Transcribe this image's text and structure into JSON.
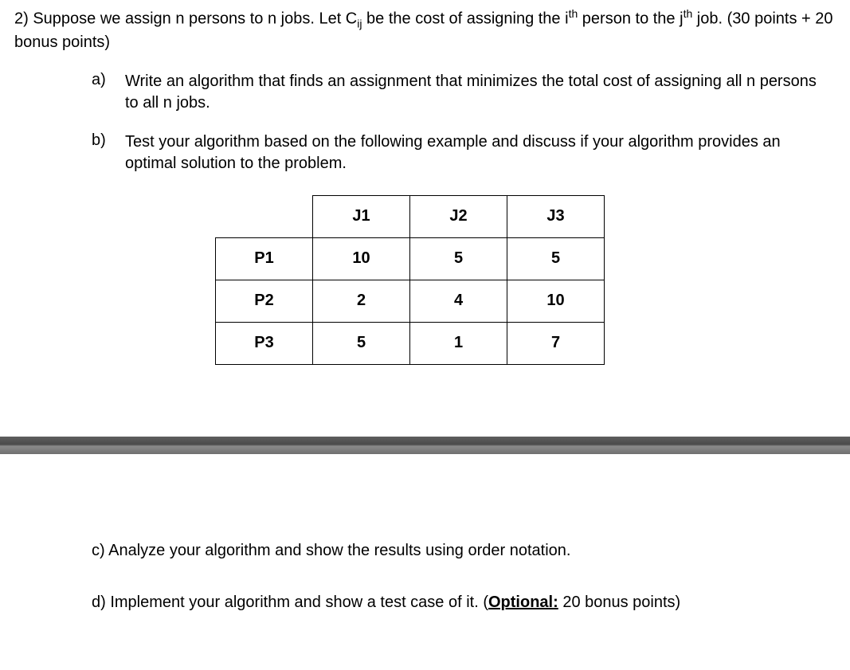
{
  "intro": {
    "prefix": "2) Suppose we assign n persons to n jobs. Let C",
    "sub": "ij",
    "mid1": " be the cost of assigning the i",
    "sup1": "th",
    "mid2": " person to the j",
    "sup2": "th",
    "suffix": " job. (30 points + 20 bonus points)"
  },
  "parts": {
    "a": {
      "letter": "a)",
      "text": "Write an algorithm that finds an assignment that minimizes the total cost of assigning all n persons to all n jobs."
    },
    "b": {
      "letter": "b)",
      "text": "Test your algorithm based on the following example and discuss if your algorithm provides an optimal solution to the problem."
    },
    "c": {
      "text": "c) Analyze your algorithm and show the results using order notation."
    },
    "d": {
      "prefix": "d) Implement your algorithm and show a test case of it. (",
      "optional": "Optional:",
      "suffix": " 20 bonus points)"
    }
  },
  "table": {
    "headers": [
      "J1",
      "J2",
      "J3"
    ],
    "rows": [
      {
        "label": "P1",
        "cells": [
          "10",
          "5",
          "5"
        ]
      },
      {
        "label": "P2",
        "cells": [
          "2",
          "4",
          "10"
        ]
      },
      {
        "label": "P3",
        "cells": [
          "5",
          "1",
          "7"
        ]
      }
    ]
  }
}
